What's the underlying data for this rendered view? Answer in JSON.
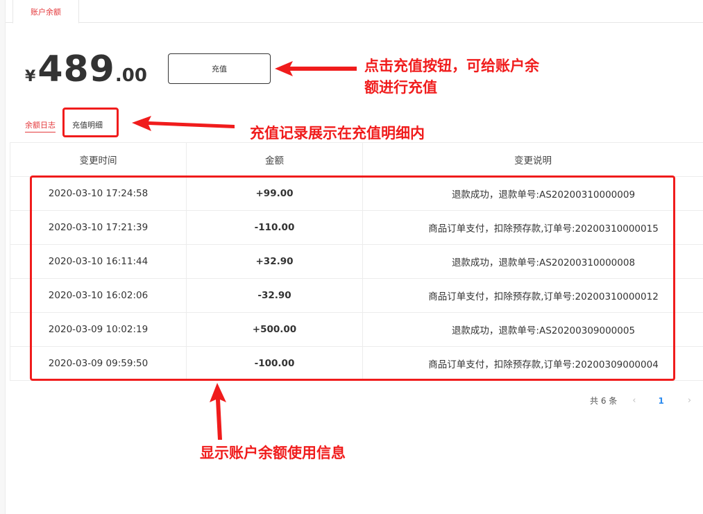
{
  "tab": {
    "label": "账户余额"
  },
  "balance": {
    "currency": "¥",
    "integer": "489",
    "decimal": ".00"
  },
  "recharge_button": {
    "label": "充值"
  },
  "subtabs": {
    "log": "余额日志",
    "detail": "充值明细"
  },
  "table": {
    "headers": [
      "变更时间",
      "金额",
      "变更说明"
    ],
    "rows": [
      {
        "time": "2020-03-10 17:24:58",
        "amount": "+99.00",
        "desc": "退款成功，退款单号:AS20200310000009"
      },
      {
        "time": "2020-03-10 17:21:39",
        "amount": "-110.00",
        "desc": "商品订单支付，扣除预存款,订单号:20200310000015"
      },
      {
        "time": "2020-03-10 16:11:44",
        "amount": "+32.90",
        "desc": "退款成功，退款单号:AS20200310000008"
      },
      {
        "time": "2020-03-10 16:02:06",
        "amount": "-32.90",
        "desc": "商品订单支付，扣除预存款,订单号:20200310000012"
      },
      {
        "time": "2020-03-09 10:02:19",
        "amount": "+500.00",
        "desc": "退款成功，退款单号:AS20200309000005"
      },
      {
        "time": "2020-03-09 09:59:50",
        "amount": "-100.00",
        "desc": "商品订单支付，扣除预存款,订单号:20200309000004"
      }
    ]
  },
  "pagination": {
    "total": "共 6 条",
    "prev": "‹",
    "current": "1",
    "next": "›"
  },
  "annotations": {
    "recharge_line1": "点击充值按钮，可给账户余",
    "recharge_line2": "额进行充值",
    "detail": "充值记录展示在充值明细内",
    "table": "显示账户余额使用信息"
  },
  "colors": {
    "accent": "#e4393c",
    "positive": "#e4393c",
    "negative": "#52b35f",
    "annotation": "#f01c1c",
    "page_link": "#2d8cf0"
  }
}
